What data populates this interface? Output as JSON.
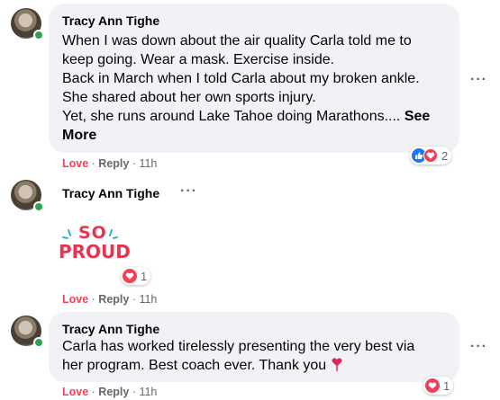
{
  "comments": [
    {
      "author": "Tracy Ann Tighe",
      "lines": [
        "When I was down about the air quality Carla told me to",
        "keep going. Wear a mask. Exercise inside.",
        "Back in March when I told Carla about my broken ankle.",
        "She shared about her own sports injury.",
        "Yet, she runs around Lake Tahoe doing Marathons.... "
      ],
      "see_more_1": "See",
      "see_more_2": "More",
      "reaction_count": "2",
      "actions": {
        "love": "Love",
        "reply": "Reply",
        "time": "11h"
      }
    },
    {
      "author": "Tracy Ann Tighe",
      "sticker_text_1": "SO",
      "sticker_text_2": "PROUD",
      "reaction_count": "1",
      "actions": {
        "love": "Love",
        "reply": "Reply",
        "time": "11h"
      }
    },
    {
      "author": "Tracy Ann Tighe",
      "lines": [
        "Carla has worked tirelessly presenting the very best via",
        "her program. Best coach ever. Thank you"
      ],
      "reaction_count": "1",
      "actions": {
        "love": "Love",
        "reply": "Reply",
        "time": "11h"
      }
    }
  ],
  "more_options": "···",
  "separator": " · ",
  "colors": {
    "love": "#f33e58",
    "like": "#1877f2",
    "online": "#31a24c",
    "bubble": "#f0f2f5"
  },
  "icons": [
    "avatar",
    "online-dot",
    "heart-emoji-icon",
    "like-reaction-icon",
    "love-reaction-icon",
    "more-options-icon"
  ]
}
